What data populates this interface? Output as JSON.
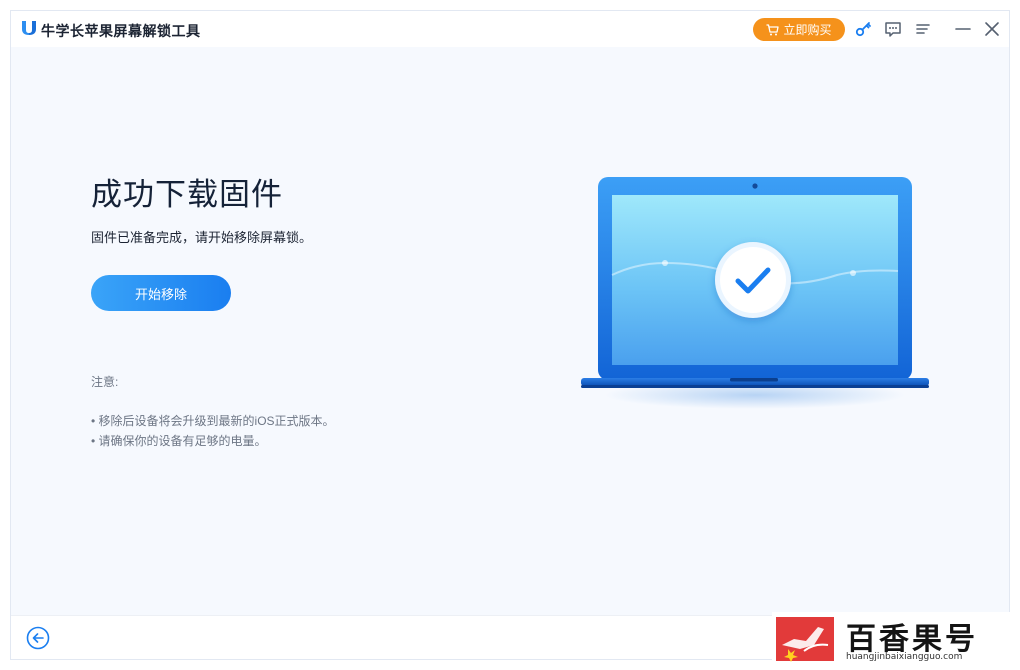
{
  "app": {
    "title": "牛学长苹果屏幕解锁工具"
  },
  "titlebar": {
    "buy_label": "立即购买",
    "icons": [
      "cart-icon",
      "key-icon",
      "message-icon",
      "menu-icon",
      "minimize-icon",
      "close-icon"
    ]
  },
  "main": {
    "title": "成功下载固件",
    "subtitle": "固件已准备完成，请开始移除屏幕锁。",
    "start_label": "开始移除",
    "note_label": "注意:",
    "notes": [
      "• 移除后设备将会升级到最新的iOS正式版本。",
      "• 请确保你的设备有足够的电量。"
    ]
  },
  "watermark": {
    "brand": "百香果号",
    "url": "huangjinbaixiangguo.com"
  },
  "colors": {
    "accent": "#1a7ef0",
    "buy": "#f5921b",
    "background": "#f6f9fe",
    "title": "#152238",
    "note": "#6d7685"
  }
}
